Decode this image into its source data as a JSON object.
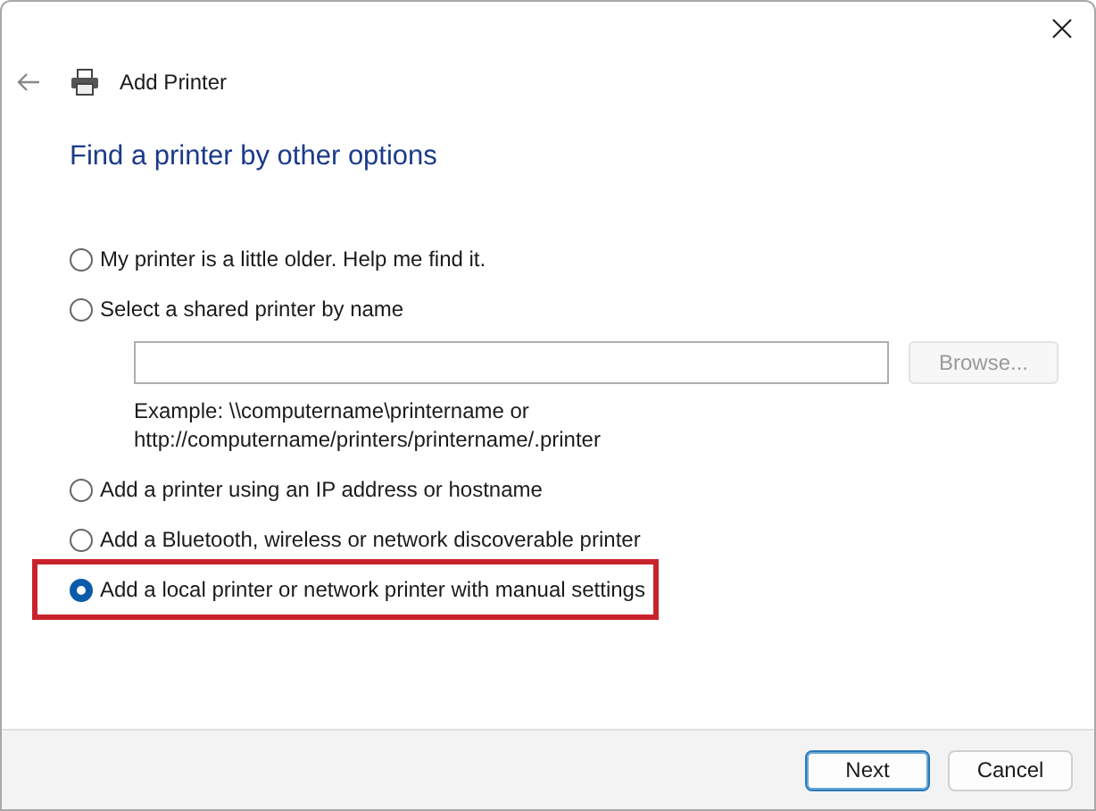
{
  "window": {
    "title": "Add Printer"
  },
  "heading": "Find a printer by other options",
  "options": [
    {
      "label": "My printer is a little older. Help me find it.",
      "selected": false,
      "highlighted": false
    },
    {
      "label": "Select a shared printer by name",
      "selected": false,
      "highlighted": false
    },
    {
      "label": "Add a printer using an IP address or hostname",
      "selected": false,
      "highlighted": false
    },
    {
      "label": "Add a Bluetooth, wireless or network discoverable printer",
      "selected": false,
      "highlighted": false
    },
    {
      "label": "Add a local printer or network printer with manual settings",
      "selected": true,
      "highlighted": true
    }
  ],
  "shared_printer": {
    "browse_button": {
      "label": "Browse...",
      "disabled": true
    },
    "example": [
      "Example: \\\\computername\\printername or",
      "http://computername/printers/printername/.printer"
    ]
  },
  "buttons": [
    {
      "label": "Next",
      "default": true
    },
    {
      "label": "Cancel",
      "default": false
    }
  ]
}
